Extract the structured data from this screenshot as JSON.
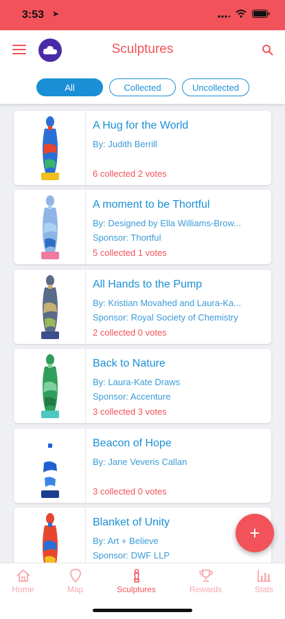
{
  "status": {
    "time": "3:53"
  },
  "header": {
    "title": "Sculptures"
  },
  "filters": {
    "all": "All",
    "collected": "Collected",
    "uncollected": "Uncollected",
    "active": "All"
  },
  "sculptures": [
    {
      "title": "A Hug for the World",
      "by": "By: Judith Berrill",
      "sponsor": "",
      "stats": "6 collected  2 votes",
      "colors": [
        "#2b6fd6",
        "#e8452f",
        "#3bb36a",
        "#f0c020"
      ]
    },
    {
      "title": "A moment to be Thortful",
      "by": "By: Designed by Ella Williams-Brow...",
      "sponsor": "Sponsor: Thortful",
      "stats": "5 collected  1 votes",
      "colors": [
        "#8fb4e6",
        "#a9d2f0",
        "#2f6fc4",
        "#f07aa0"
      ]
    },
    {
      "title": "All Hands to the Pump",
      "by": "By: Kristian Movahed and Laura-Ka...",
      "sponsor": "Sponsor: Royal Society of Chemistry",
      "stats": "2 collected  0 votes",
      "colors": [
        "#5a6b8a",
        "#c7b070",
        "#9ab85a",
        "#3c4f8a"
      ]
    },
    {
      "title": "Back to Nature",
      "by": "By: Laura-Kate Draws",
      "sponsor": "Sponsor: Accenture",
      "stats": "3 collected  3 votes",
      "colors": [
        "#2f9e5a",
        "#7fd0a0",
        "#1f7a48",
        "#4fc7c0"
      ]
    },
    {
      "title": "Beacon of Hope",
      "by": "By: Jane Veveris Callan",
      "sponsor": "",
      "stats": "3 collected  0 votes",
      "colors": [
        "#ffffff",
        "#1f5fd0",
        "#3a86e6",
        "#1a3f90"
      ]
    },
    {
      "title": "Blanket of Unity",
      "by": "By: Art + Believe",
      "sponsor": "Sponsor: DWF LLP",
      "stats": "",
      "colors": [
        "#e8452f",
        "#2b6fd6",
        "#f0c020",
        "#8a3fc0"
      ]
    }
  ],
  "fab": {
    "label": "+"
  },
  "tabs": [
    {
      "label": "Home",
      "icon": "home-icon"
    },
    {
      "label": "Map",
      "icon": "map-pin-icon"
    },
    {
      "label": "Sculptures",
      "icon": "sculpture-icon"
    },
    {
      "label": "Rewards",
      "icon": "trophy-icon"
    },
    {
      "label": "Stats",
      "icon": "stats-icon"
    }
  ],
  "active_tab": "Sculptures",
  "colors": {
    "brand_red": "#f2525a",
    "brand_blue": "#1a8fd6",
    "logo_purple": "#4b2aa8"
  }
}
